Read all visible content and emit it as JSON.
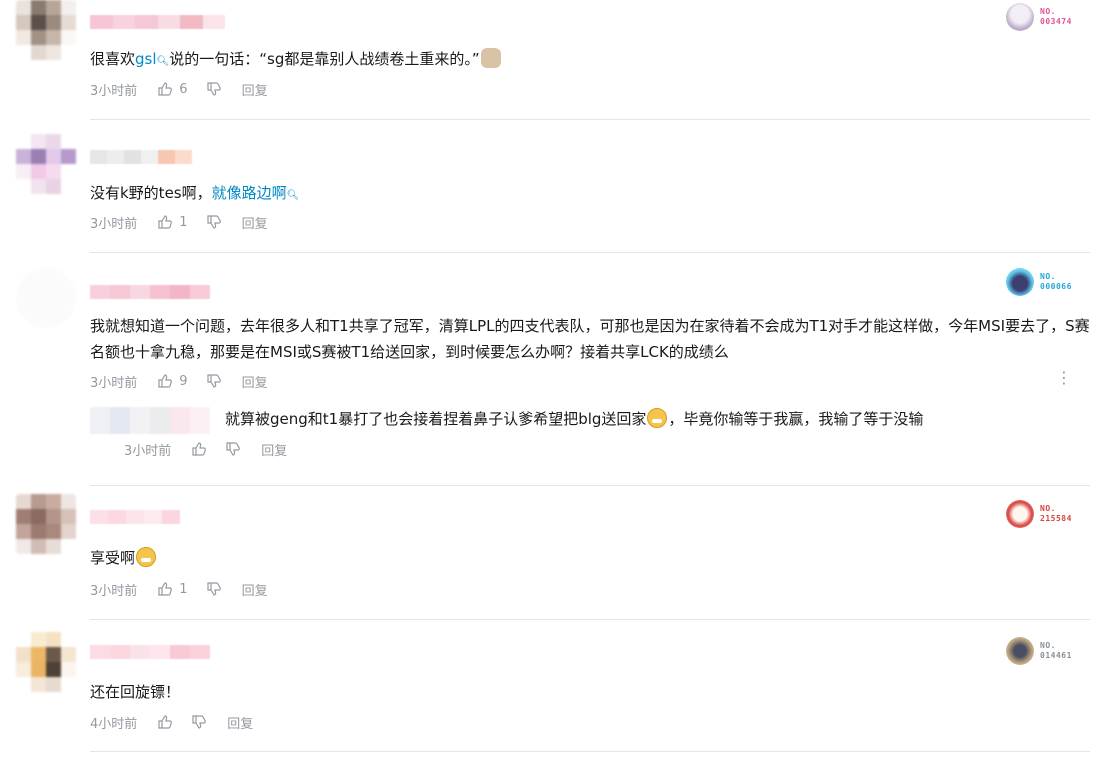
{
  "comments": [
    {
      "text_before": "很喜欢",
      "link": "gsl",
      "text_after": "说的一句话：“sg都是靠别人战绩卷土重来的。”",
      "time": "3小时前",
      "likes": "6",
      "reply_label": "回复",
      "badge_no": "NO.\n003474",
      "badge_color": "#e0559a"
    },
    {
      "text_before": "没有k野的tes啊，",
      "link": "就像路边啊",
      "text_after": "",
      "time": "3小时前",
      "likes": "1",
      "reply_label": "回复"
    },
    {
      "text": "我就想知道一个问题，去年很多人和T1共享了冠军，清算LPL的四支代表队，可那也是因为在家待着不会成为T1对手才能这样做，今年MSI要去了，S赛名额也十拿九稳，那要是在MSI或S赛被T1给送回家，到时候要怎么办啊？接着共享LCK的成绩么",
      "time": "3小时前",
      "likes": "9",
      "reply_label": "回复",
      "badge_no": "NO.\n000066",
      "badge_color": "#26a6d9",
      "reply": {
        "text_before": "就算被geng和t1暴打了也会接着捏着鼻子认爹希望把blg送回家",
        "text_after": "，毕竟你输等于我赢，我输了等于没输",
        "time": "3小时前",
        "reply_label": "回复"
      }
    },
    {
      "text": "享受啊",
      "time": "3小时前",
      "likes": "1",
      "reply_label": "回复",
      "badge_no": "NO.\n215584",
      "badge_color": "#d8443f"
    },
    {
      "text": "还在回旋镖！",
      "time": "4小时前",
      "likes": "",
      "reply_label": "回复",
      "badge_no": "NO.\n014461",
      "badge_color": "#8a8f96"
    }
  ]
}
